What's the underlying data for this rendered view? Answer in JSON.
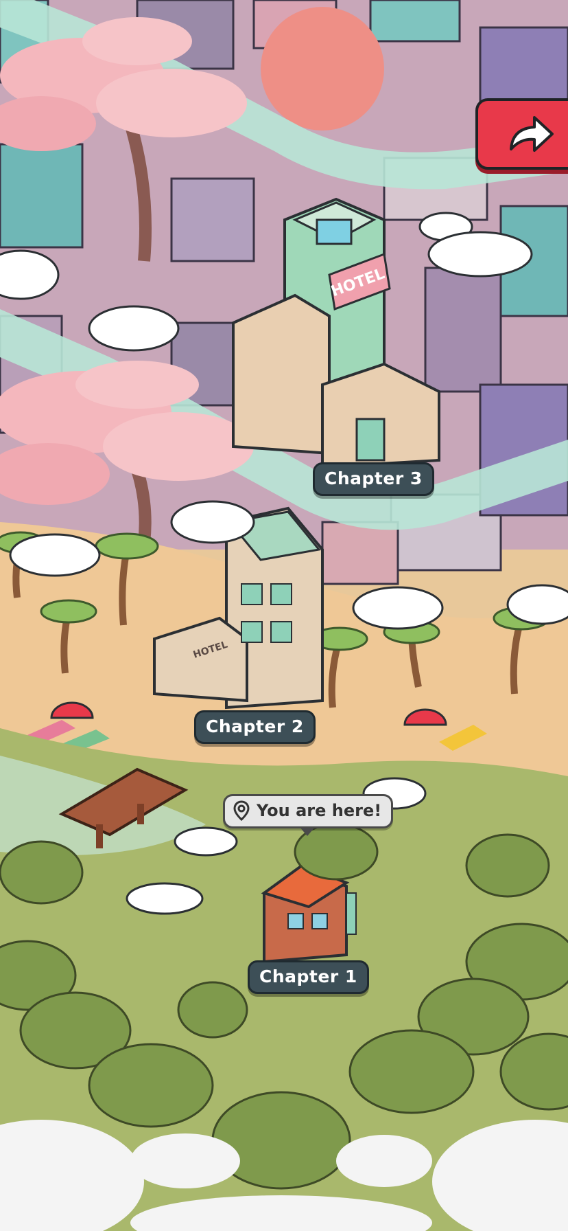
{
  "map": {
    "chapters": [
      {
        "label": "Chapter 3"
      },
      {
        "label": "Chapter 2"
      },
      {
        "label": "Chapter 1"
      }
    ],
    "location_tooltip": "You are here!",
    "building_signs": [
      "HOTEL",
      "HOTEL"
    ]
  },
  "controls": {
    "share_icon": "share-arrow-icon",
    "share_color": "#e8394a"
  },
  "palette": {
    "sand": "#efc896",
    "grass": "#a9b86c",
    "river": "#b8e5d6",
    "sakura": "#f4b7bd",
    "city": "#b99fb8"
  }
}
